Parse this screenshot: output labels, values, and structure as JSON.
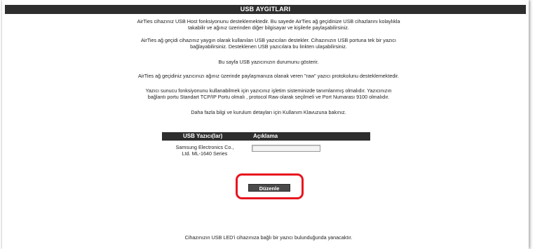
{
  "page": {
    "title": "USB AYGITLARI",
    "paragraphs": [
      [
        "AirTies cihazınız USB Host fonksiyonunu desteklemektedir. Bu sayede AirTies ağ geçidinize USB cihazlarını kolaylıkla",
        "takabilir ve ağınız üzerinden diğer bilgisayar ve kişilerle paylaşabilirsiniz."
      ],
      [
        "AirTies ağ geçidi cihazınız yaygın olarak kullanılan USB yazıcıları destekler. Cihazınızın USB portuna tek bir yazıcı",
        "bağlayabilirsiniz. Desteklenen USB yazıcılara bu linkten ulaşabilirsiniz."
      ],
      [
        "Bu sayfa USB yazıcınızın durumunu gösterir."
      ],
      [
        "AirTies ağ geçidiniz yazıcınızı ağınız üzerinde paylaşmanıza olanak veren \"raw\" yazıcı protokolunu desteklemektedir."
      ],
      [
        "Yazıcı sunucu fonksiyonunu kullanabilmek için yazıcınız işletim sisteminizde tanımlanmış olmalıdır. Yazıcınızın",
        "bağlantı portu Standart TCP/IP Portu olmalı , protocol Raw olarak seçilmeli ve Port Numarası 9100 olmalıdır."
      ],
      [
        "Daha fazla bilgi ve kurulum detayları için Kullanım Klavuzuna bakınız."
      ]
    ]
  },
  "printers_table": {
    "headers": [
      "USB Yazıcı(lar)",
      "Açıklama"
    ],
    "rows": [
      {
        "printer_lines": [
          "Samsung Electronics Co.,",
          "Ltd. ML-1640 Series"
        ],
        "description": ""
      }
    ]
  },
  "edit_button_label": "Düzenle",
  "footer_note": "Cihazınızın USB LED'i cihazınıza bağlı bir yazıcı bulunduğunda yanacaktır.",
  "colors": {
    "header_bg": "#2e2e2e",
    "highlight": "#e8141e"
  }
}
